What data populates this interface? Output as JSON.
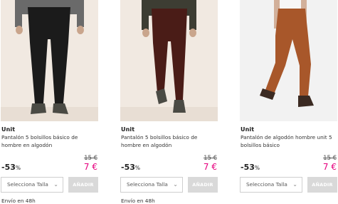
{
  "products": [
    {
      "brand": "Unit",
      "title": "Pantalón 5 bolsillos básico de hombre en algodón",
      "old_price": "15 €",
      "discount": "-53",
      "discount_unit": "%",
      "price": "7 €",
      "size_placeholder": "Selecciona Talla",
      "add_label": "AÑADIR",
      "shipping": "Envío en 48h",
      "pants_color": "#1b1b1b",
      "top_color": "#6a6a6a",
      "bg_color": "#f1e9e1"
    },
    {
      "brand": "Unit",
      "title": "Pantalón 5 bolsillos básico de hombre en algodón",
      "old_price": "15 €",
      "discount": "-53",
      "discount_unit": "%",
      "price": "7 €",
      "size_placeholder": "Selecciona Talla",
      "add_label": "AÑADIR",
      "shipping": "Envío en 48h",
      "pants_color": "#4a1c17",
      "top_color": "#3d3d33",
      "bg_color": "#f1e9e1"
    },
    {
      "brand": "Unit",
      "title": "Pantalón de algodón hombre unit 5 bolsillos básico",
      "old_price": "15 €",
      "discount": "-53",
      "discount_unit": "%",
      "price": "7 €",
      "size_placeholder": "Selecciona Talla",
      "add_label": "AÑADIR",
      "pants_color": "#a8572a",
      "top_color": "#f7f7f7",
      "bg_color": "#f2f2f2"
    }
  ],
  "colors": {
    "price": "#e6007e",
    "add_button_bg": "#d9d9d9"
  },
  "icons": {
    "select_chevron": "chevron-down-icon"
  }
}
